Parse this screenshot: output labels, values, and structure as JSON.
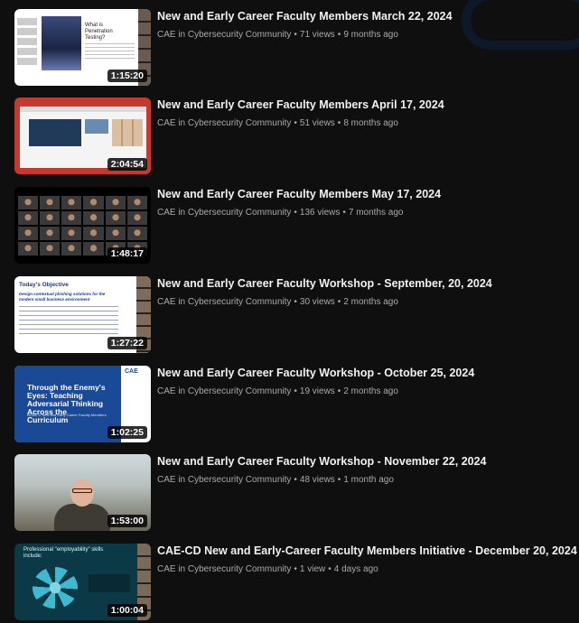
{
  "videos": [
    {
      "title": "New and Early Career Faculty Members March 22, 2024",
      "channel": "CAE in Cybersecurity Community",
      "views": "71 views",
      "age": "9 months ago",
      "duration": "1:15:20",
      "thumb_text": "What is Penetration Testing?"
    },
    {
      "title": "New and Early Career Faculty Members April 17, 2024",
      "channel": "CAE in Cybersecurity Community",
      "views": "51 views",
      "age": "8 months ago",
      "duration": "2:04:54",
      "thumb_text": ""
    },
    {
      "title": "New and Early Career Faculty Members May 17, 2024",
      "channel": "CAE in Cybersecurity Community",
      "views": "136 views",
      "age": "7 months ago",
      "duration": "1:48:17",
      "thumb_text": ""
    },
    {
      "title": "New and Early Career Faculty Workshop - September, 20, 2024",
      "channel": "CAE in Cybersecurity Community",
      "views": "30 views",
      "age": "2 months ago",
      "duration": "1:27:22",
      "thumb_text": "Today's Objective",
      "thumb_sub": "Design contextual phishing solutions for the modern small business environment"
    },
    {
      "title": "New and Early Career Faculty Workshop - October 25, 2024",
      "channel": "CAE in Cybersecurity Community",
      "views": "19 views",
      "age": "2 months ago",
      "duration": "1:02:25",
      "thumb_text": "Through the Enemy's Eyes: Teaching Adversarial Thinking Across the Curriculum",
      "thumb_sub": "NCAE-C New and Early Career Faculty Members",
      "thumb_logo": "CAE"
    },
    {
      "title": "New and Early Career Faculty Workshop - November 22, 2024",
      "channel": "CAE in Cybersecurity Community",
      "views": "48 views",
      "age": "1 month ago",
      "duration": "1:53:00",
      "thumb_text": ""
    },
    {
      "title": "CAE-CD New and Early-Career Faculty Members Initiative - December 20, 2024",
      "channel": "CAE in Cybersecurity Community",
      "views": "1 view",
      "age": "4 days ago",
      "duration": "1:00:04",
      "thumb_text": "Professional \"employability\" skills include:"
    }
  ],
  "separator": "•"
}
